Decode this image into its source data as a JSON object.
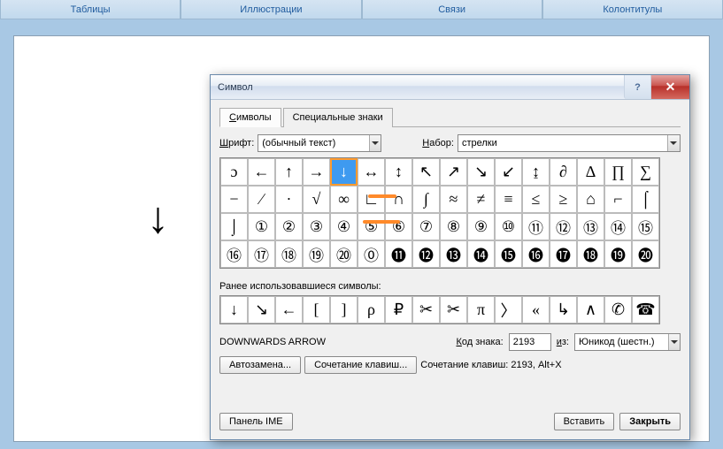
{
  "ribbon": {
    "groups": [
      "Таблицы",
      "Иллюстрации",
      "Связи",
      "Колонтитулы"
    ]
  },
  "document": {
    "sample_char": "↓"
  },
  "dialog": {
    "title": "Символ",
    "help": "?",
    "close": "✕",
    "tabs": {
      "symbols": "Символы",
      "special": "Специальные знаки"
    },
    "font_label": "Шрифт:",
    "font_value": "(обычный текст)",
    "set_label": "Набор:",
    "set_value": "стрелки",
    "grid": [
      [
        "ɔ",
        "←",
        "↑",
        "→",
        "↓",
        "↔",
        "↕",
        "↖",
        "↗",
        "↘",
        "↙",
        "↨",
        "∂",
        "∆",
        "∏",
        "∑"
      ],
      [
        "−",
        "∕",
        "∙",
        "√",
        "∞",
        "∟",
        "∩",
        "∫",
        "≈",
        "≠",
        "≡",
        "≤",
        "≥",
        "⌂",
        "⌐",
        "⌠"
      ],
      [
        "⌡",
        "①",
        "②",
        "③",
        "④",
        "⑤",
        "⑥",
        "⑦",
        "⑧",
        "⑨",
        "⑩",
        "⑪",
        "⑫",
        "⑬",
        "⑭",
        "⑮"
      ],
      [
        "⑯",
        "⑰",
        "⑱",
        "⑲",
        "⑳",
        "⓪",
        "⓫",
        "⓬",
        "⓭",
        "⓮",
        "⓯",
        "⓰",
        "⓱",
        "⓲",
        "⓳",
        "⓴"
      ]
    ],
    "selected": {
      "row": 0,
      "col": 4
    },
    "recent_label": "Ранее использовавшиеся символы:",
    "recent": [
      "↓",
      "↘",
      "←",
      "[",
      "]",
      "ρ",
      "₽",
      "✂",
      "✂",
      "π",
      "〉",
      "«",
      "↳",
      "∧",
      "✆",
      "☎"
    ],
    "char_name": "DOWNWARDS ARROW",
    "code_label": "Код знака:",
    "code_value": "2193",
    "from_label": "из:",
    "from_value": "Юникод (шестн.)",
    "autocorrect": "Автозамена...",
    "shortcut_btn": "Сочетание клавиш...",
    "shortcut_label": "Сочетание клавиш: 2193, Alt+X",
    "ime": "Панель IME",
    "insert": "Вставить",
    "close_btn": "Закрыть"
  }
}
